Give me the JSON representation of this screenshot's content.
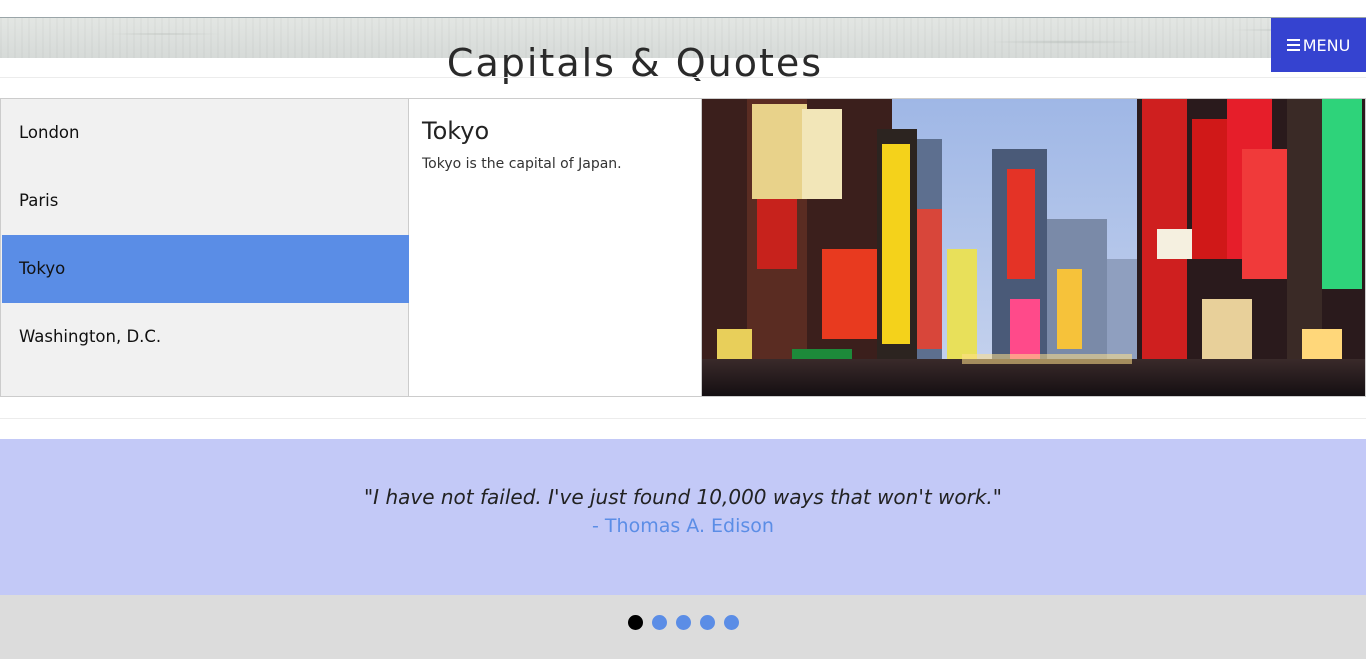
{
  "header": {
    "title": "Capitals & Quotes",
    "menu_label": "MENU"
  },
  "cities": {
    "items": [
      {
        "label": "London"
      },
      {
        "label": "Paris"
      },
      {
        "label": "Tokyo"
      },
      {
        "label": "Washington, D.C."
      }
    ],
    "selected": "Tokyo"
  },
  "detail": {
    "title": "Tokyo",
    "text": "Tokyo is the capital of Japan."
  },
  "quote": {
    "text": "\"I have not failed. I've just found 10,000 ways that won't work.\"",
    "author": "- Thomas A. Edison"
  },
  "slider": {
    "count": 5,
    "active_index": 0
  },
  "colors": {
    "menu_bg": "#3543d0",
    "active_item": "#5a8de6",
    "quote_band": "#c3c9f7",
    "author_text": "#5b8de6",
    "dot": "#5b8de6",
    "dot_active": "#000000"
  }
}
